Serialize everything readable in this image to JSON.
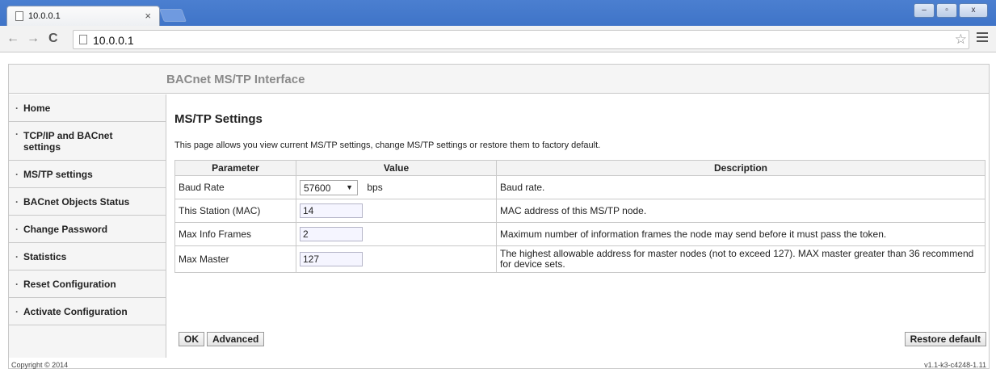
{
  "browser": {
    "tab_title": "10.0.0.1",
    "tab_close": "×",
    "url": "10.0.0.1",
    "back": "←",
    "forward": "→",
    "reload": "C",
    "star": "☆",
    "minimize": "–",
    "maximize": "▫",
    "close": "x"
  },
  "header": {
    "app_title": "BACnet MS/TP Interface"
  },
  "sidebar": {
    "items": [
      {
        "label": "Home"
      },
      {
        "label": "TCP/IP and BACnet settings"
      },
      {
        "label": "MS/TP settings"
      },
      {
        "label": "BACnet Objects Status"
      },
      {
        "label": "Change Password"
      },
      {
        "label": "Statistics"
      },
      {
        "label": "Reset Configuration"
      },
      {
        "label": "Activate Configuration"
      }
    ]
  },
  "main": {
    "title": "MS/TP Settings",
    "description": "This page allows you view current MS/TP settings, change MS/TP settings or restore them to factory default.",
    "table": {
      "headers": [
        "Parameter",
        "Value",
        "Description"
      ],
      "rows": [
        {
          "param": "Baud Rate",
          "value": "57600",
          "unit": "bps",
          "desc": "Baud rate."
        },
        {
          "param": "This Station (MAC)",
          "value": "14",
          "desc": "MAC address of this MS/TP node."
        },
        {
          "param": "Max Info Frames",
          "value": "2",
          "desc": "Maximum number of information frames the node may send before it must pass the token."
        },
        {
          "param": "Max Master",
          "value": "127",
          "desc": "The highest allowable address for master nodes (not to exceed 127). MAX master greater than 36 recommend for device sets."
        }
      ]
    },
    "buttons": {
      "ok": "OK",
      "advanced": "Advanced",
      "restore": "Restore default"
    }
  },
  "footer": {
    "copyright": "Copyright © 2014",
    "version": "v1.1-k3-c4248-1.11"
  }
}
